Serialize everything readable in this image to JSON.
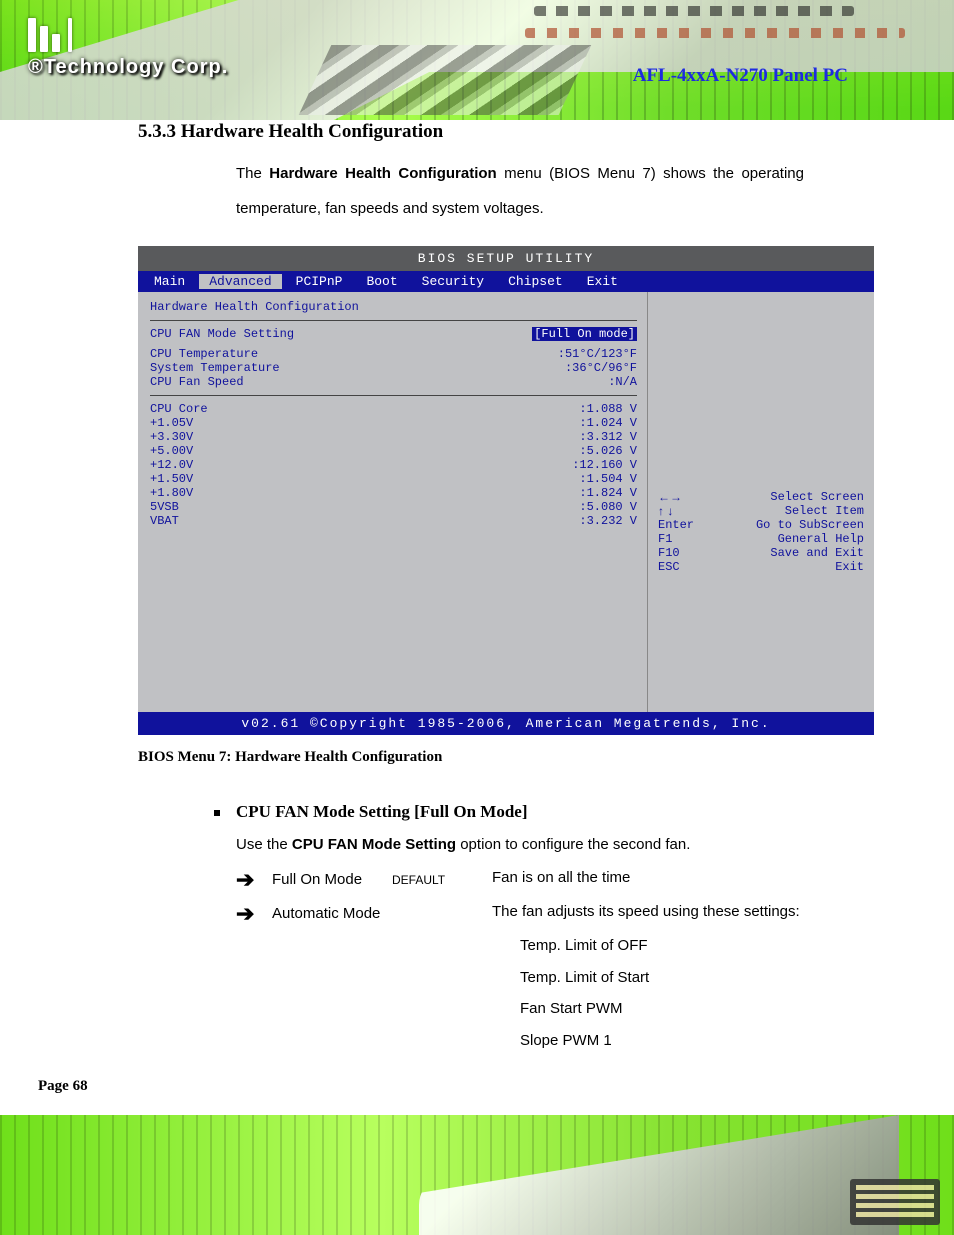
{
  "logo_tag": "®Technology Corp.",
  "doc_title": "AFL-4xxA-N270 Panel PC",
  "section_head": "5.3.3  Hardware Health Configuration",
  "intro": {
    "prefix": "The ",
    "bold": "Hardware Health Configuration",
    "suffix": " menu (BIOS Menu 7) shows the operating temperature, fan speeds and system voltages."
  },
  "bios": {
    "top": "BIOS SETUP UTILITY",
    "tabs": [
      "Main",
      "Advanced",
      "PCIPnP",
      "Boot",
      "Security",
      "Chipset",
      "Exit"
    ],
    "active_tab": "Advanced",
    "heading": "Hardware Health Configuration",
    "rows_a": [
      [
        "CPU FAN Mode Setting",
        "[Full On mode]"
      ],
      [
        "CPU Temperature",
        ":51°C/123°F"
      ],
      [
        "System Temperature",
        ":36°C/96°F"
      ],
      [
        "CPU Fan Speed",
        ":N/A"
      ]
    ],
    "rows_b": [
      [
        "CPU Core",
        ":1.088 V"
      ],
      [
        "+1.05V",
        ":1.024 V"
      ],
      [
        "+3.30V",
        ":3.312 V"
      ],
      [
        "+5.00V",
        ":5.026 V"
      ],
      [
        "+12.0V",
        ":12.160 V"
      ],
      [
        "+1.50V",
        ":1.504 V"
      ],
      [
        "+1.80V",
        ":1.824 V"
      ],
      [
        "5VSB",
        ":5.080 V"
      ],
      [
        "VBAT",
        ":3.232 V"
      ]
    ],
    "legend": [
      [
        "←→",
        "Select Screen"
      ],
      [
        "↑ ↓",
        "Select Item"
      ],
      [
        "Enter",
        "Go to SubScreen"
      ],
      [
        "F1",
        "General Help"
      ],
      [
        "F10",
        "Save and Exit"
      ],
      [
        "ESC",
        "Exit"
      ]
    ],
    "bottom": "v02.61 ©Copyright 1985-2006, American Megatrends, Inc."
  },
  "caption": "BIOS Menu 7: Hardware Health Configuration",
  "option": {
    "head": "CPU FAN Mode Setting [Full On Mode]",
    "desc_prefix": "Use the ",
    "desc_bold": "CPU FAN Mode Setting",
    "desc_suffix": " option to configure the second fan.",
    "items": [
      {
        "key": "Full On Mode",
        "def": "DEFAULT",
        "desc": "Fan is on all the time",
        "sub": []
      },
      {
        "key": "Automatic Mode",
        "def": "",
        "desc": "The fan adjusts its speed using these settings:",
        "sub": [
          "Temp. Limit of OFF",
          "Temp. Limit of Start",
          "Fan Start PWM",
          "Slope PWM 1"
        ]
      }
    ]
  },
  "page_num": "Page 68"
}
